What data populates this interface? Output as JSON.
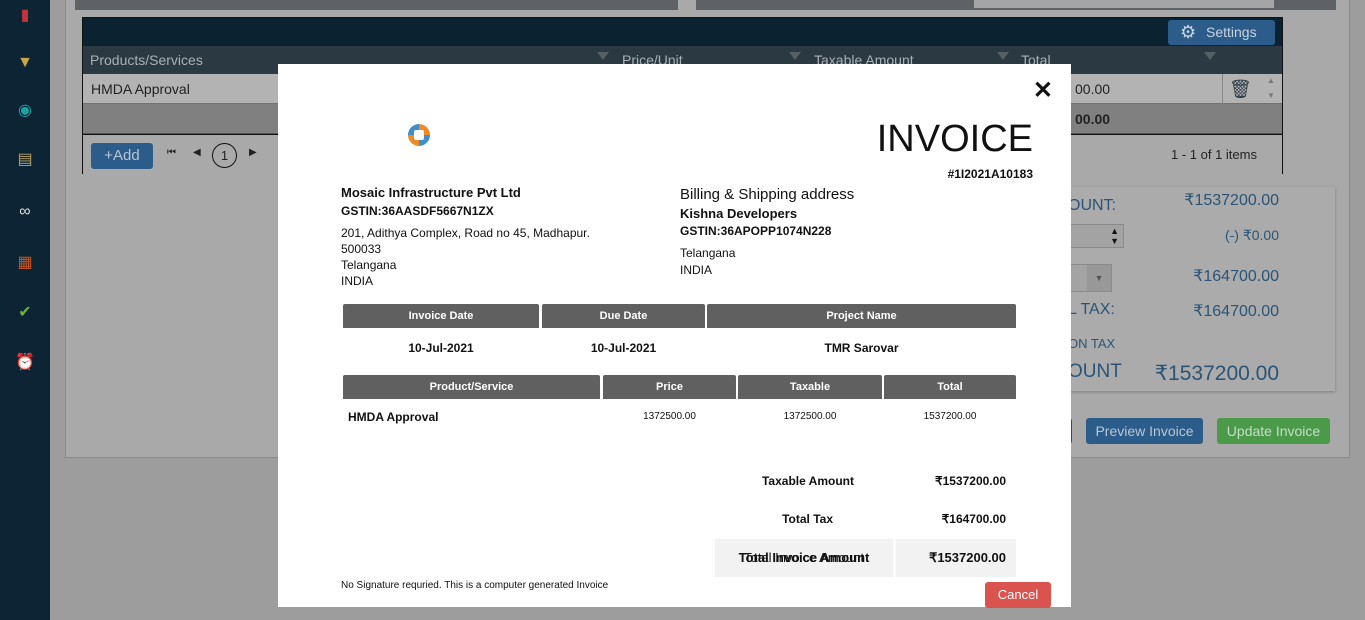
{
  "sidebar": {
    "icons": [
      "invoice-icon",
      "filter-search-icon",
      "target-icon",
      "clipboard-check-icon",
      "binoculars-icon",
      "ledger-icon",
      "check-circle-icon",
      "alarm-clock-icon"
    ]
  },
  "grid": {
    "settings_label": "Settings",
    "columns": [
      "Products/Services",
      "Price/Unit",
      "Taxable Amount",
      "Total"
    ],
    "row": {
      "product": "HMDA Approval",
      "total_partial": "00.00"
    },
    "footer_total_partial": "00.00",
    "add_label": "+Add",
    "current_page": "1",
    "items_info": "1 - 1 of 1 items"
  },
  "summary": {
    "label1": "OUNT:",
    "value1": "₹1537200.00",
    "value2": "(-) ₹0.00",
    "value3": "₹164700.00",
    "label4": "L TAX:",
    "value4": "₹164700.00",
    "label5": "ON TAX",
    "label6": "OUNT",
    "value6": "₹1537200.00"
  },
  "buttons": {
    "preview": "Preview Invoice",
    "update": "Update Invoice"
  },
  "colors": {
    "primary": "#2b5c8a",
    "success": "#4a9a4a",
    "danger": "#d9534f",
    "table_header": "#606060"
  },
  "modal": {
    "title": "INVOICE",
    "invoice_no": "#1I2021A10183",
    "seller": {
      "name": "Mosaic Infrastructure Pvt Ltd",
      "gstin": "GSTIN:36AASDF5667N1ZX",
      "address": "201, Adithya Complex, Road no 45, Madhapur.",
      "pin": "500033",
      "state": "Telangana",
      "country": "INDIA"
    },
    "buyer": {
      "heading": "Billing & Shipping address",
      "name": "Kishna Developers",
      "gstin": "GSTIN:36APOPP1074N228",
      "state": "Telangana",
      "country": "INDIA"
    },
    "info_headers": [
      "Invoice Date",
      "Due Date",
      "Project Name"
    ],
    "info_values": [
      "10-Jul-2021",
      "10-Jul-2021",
      "TMR Sarovar"
    ],
    "item_headers": [
      "Product/Service",
      "Price",
      "Taxable",
      "Total"
    ],
    "items": [
      {
        "product": "HMDA Approval",
        "price": "1372500.00",
        "taxable": "1372500.00",
        "total": "1537200.00"
      }
    ],
    "totals": {
      "taxable_label": "Taxable Amount",
      "taxable": "₹1537200.00",
      "tax_label": "Total Tax",
      "tax": "₹164700.00",
      "grand_label": "Total Invoice Amount",
      "grand": "₹1537200.00"
    },
    "footer_note": "No Signature requried. This is a computer generated Invoice",
    "cancel_label": "Cancel"
  }
}
